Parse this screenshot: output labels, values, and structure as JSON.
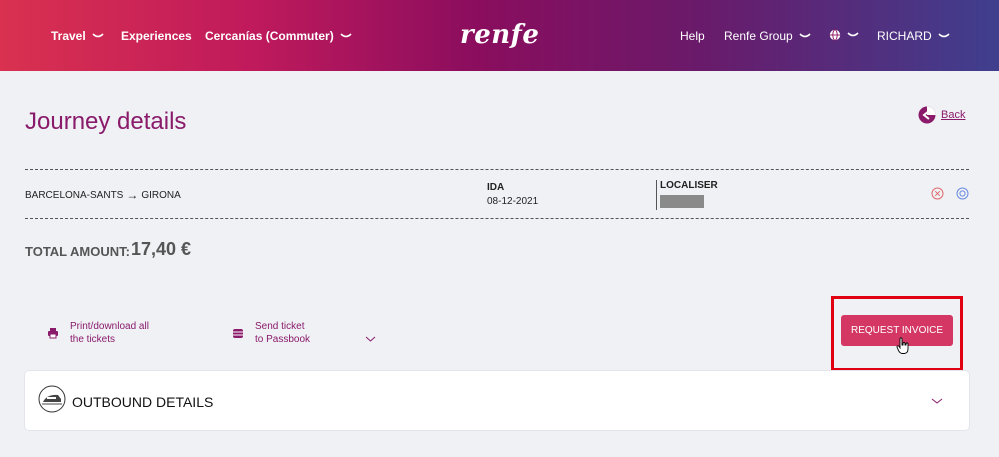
{
  "header": {
    "nav_left": [
      "Travel",
      "Experiences",
      "Cercanías (Commuter)"
    ],
    "logo": "renfe",
    "nav_right": [
      "Help",
      "Renfe Group",
      "RICHARD"
    ]
  },
  "page": {
    "title": "Journey details",
    "back_label": "Back"
  },
  "journey": {
    "origin": "BARCELONA-SANTS",
    "arrow": "→",
    "destination": "GIRONA",
    "direction_label": "IDA",
    "date": "08-12-2021",
    "localiser_label": "LOCALISER"
  },
  "total": {
    "label": "TOTAL AMOUNT:",
    "value": "17,40 €"
  },
  "actions": {
    "print_line1": "Print/download all",
    "print_line2": "the tickets",
    "passbook_line1": "Send ticket",
    "passbook_line2": "to Passbook",
    "invoice_label": "REQUEST INVOICE"
  },
  "outbound": {
    "title": "OUTBOUND DETAILS"
  },
  "colors": {
    "accent": "#8a1a6a",
    "button": "#d43764",
    "highlight": "#e00012"
  }
}
